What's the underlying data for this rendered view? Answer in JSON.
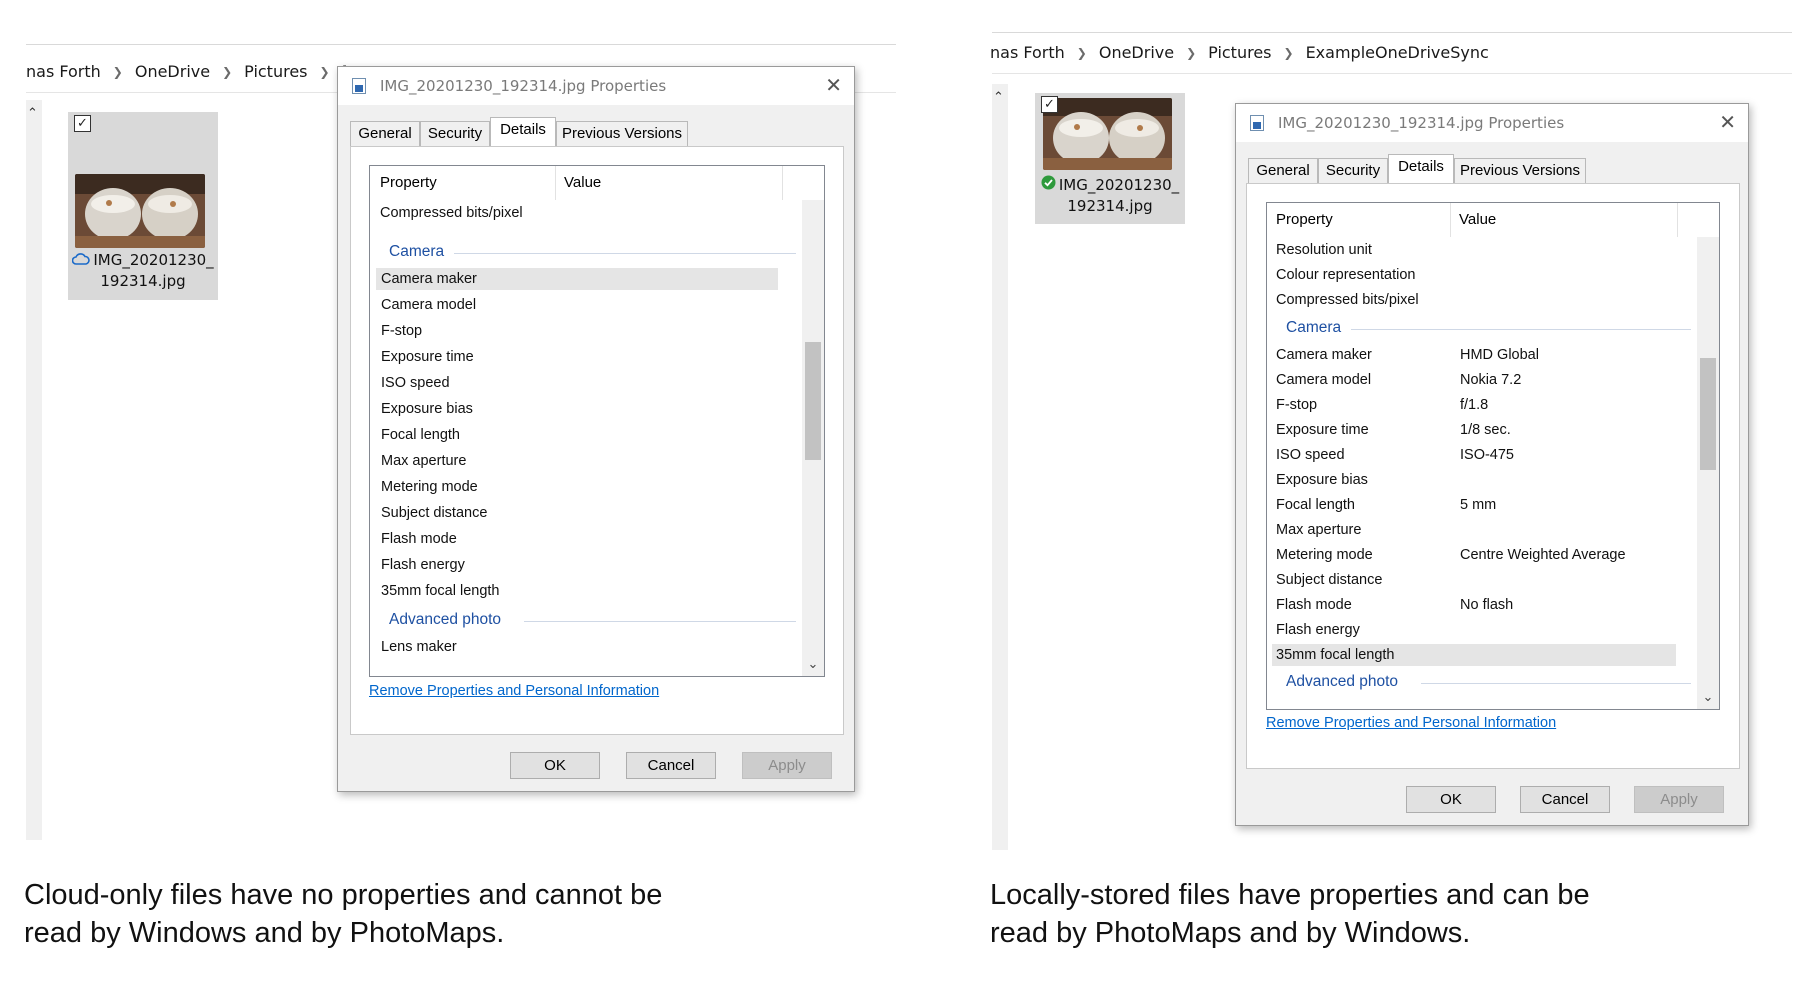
{
  "left": {
    "breadcrumb": [
      "nas Forth",
      "OneDrive",
      "Pictures",
      "Ex"
    ],
    "file": {
      "name_line1": "IMG_20201230_",
      "name_line2": "192314.jpg",
      "status": "cloud-outline-icon"
    },
    "dialog": {
      "title": "IMG_20201230_192314.jpg Properties",
      "tabs": [
        "General",
        "Security",
        "Details",
        "Previous Versions"
      ],
      "active_tab": "Details",
      "col_property": "Property",
      "col_value": "Value",
      "rows_top": [
        {
          "property": "Compressed bits/pixel",
          "value": ""
        }
      ],
      "group_camera": "Camera",
      "camera_rows": [
        {
          "property": "Camera maker",
          "value": ""
        },
        {
          "property": "Camera model",
          "value": ""
        },
        {
          "property": "F-stop",
          "value": ""
        },
        {
          "property": "Exposure time",
          "value": ""
        },
        {
          "property": "ISO speed",
          "value": ""
        },
        {
          "property": "Exposure bias",
          "value": ""
        },
        {
          "property": "Focal length",
          "value": ""
        },
        {
          "property": "Max aperture",
          "value": ""
        },
        {
          "property": "Metering mode",
          "value": ""
        },
        {
          "property": "Subject distance",
          "value": ""
        },
        {
          "property": "Flash mode",
          "value": ""
        },
        {
          "property": "Flash energy",
          "value": ""
        },
        {
          "property": "35mm focal length",
          "value": ""
        }
      ],
      "group_advanced": "Advanced photo",
      "advanced_rows": [
        {
          "property": "Lens maker",
          "value": ""
        }
      ],
      "remove_link": "Remove Properties and Personal Information",
      "ok": "OK",
      "cancel": "Cancel",
      "apply": "Apply"
    },
    "caption_line1": "Cloud-only files have no properties and cannot be",
    "caption_line2": "read by Windows and by PhotoMaps."
  },
  "right": {
    "breadcrumb": [
      "nas Forth",
      "OneDrive",
      "Pictures",
      "ExampleOneDriveSync"
    ],
    "file": {
      "name_line1": "IMG_20201230_",
      "name_line2": "192314.jpg",
      "status": "green-check-icon"
    },
    "dialog": {
      "title": "IMG_20201230_192314.jpg Properties",
      "tabs": [
        "General",
        "Security",
        "Details",
        "Previous Versions"
      ],
      "active_tab": "Details",
      "col_property": "Property",
      "col_value": "Value",
      "rows_top": [
        {
          "property": "Resolution unit",
          "value": ""
        },
        {
          "property": "Colour representation",
          "value": ""
        },
        {
          "property": "Compressed bits/pixel",
          "value": ""
        }
      ],
      "group_camera": "Camera",
      "camera_rows": [
        {
          "property": "Camera maker",
          "value": "HMD Global"
        },
        {
          "property": "Camera model",
          "value": "Nokia 7.2"
        },
        {
          "property": "F-stop",
          "value": "f/1.8"
        },
        {
          "property": "Exposure time",
          "value": "1/8 sec."
        },
        {
          "property": "ISO speed",
          "value": "ISO-475"
        },
        {
          "property": "Exposure bias",
          "value": ""
        },
        {
          "property": "Focal length",
          "value": "5 mm"
        },
        {
          "property": "Max aperture",
          "value": ""
        },
        {
          "property": "Metering mode",
          "value": "Centre Weighted Average"
        },
        {
          "property": "Subject distance",
          "value": ""
        },
        {
          "property": "Flash mode",
          "value": "No flash"
        },
        {
          "property": "Flash energy",
          "value": ""
        },
        {
          "property": "35mm focal length",
          "value": ""
        }
      ],
      "group_advanced": "Advanced photo",
      "remove_link": "Remove Properties and Personal Information",
      "ok": "OK",
      "cancel": "Cancel",
      "apply": "Apply"
    },
    "caption_line1": "Locally-stored files have properties and can be",
    "caption_line2": "read by PhotoMaps and by Windows."
  }
}
